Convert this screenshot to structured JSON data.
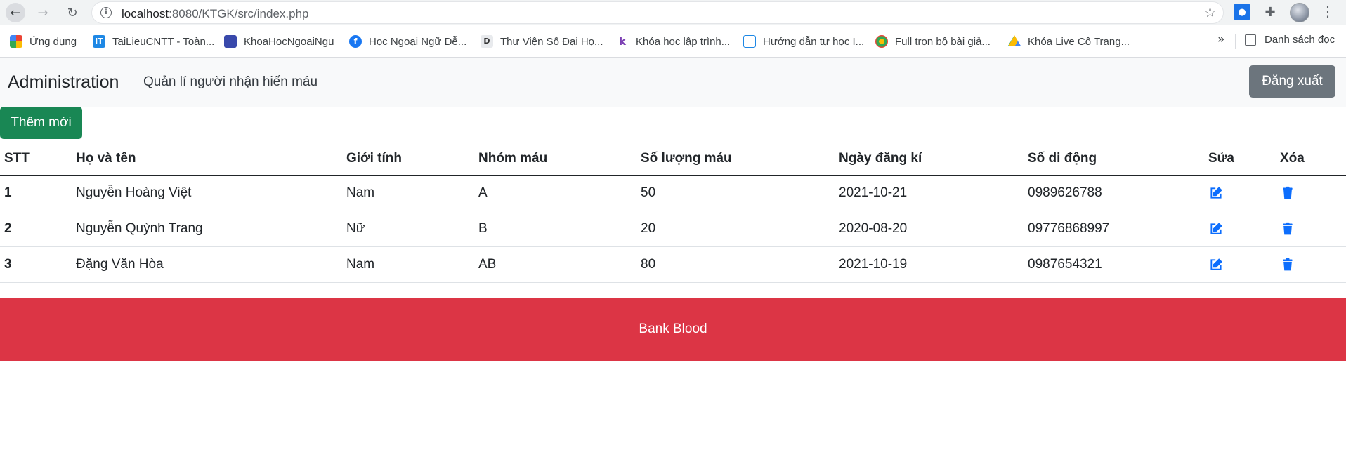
{
  "browser": {
    "url_host": "localhost",
    "url_path": ":8080/KTGK/src/index.php",
    "bookmarks": [
      {
        "label": "Ứng dụng",
        "icon": "apps-grid-icon"
      },
      {
        "label": "TaiLieuCNTT - Toàn...",
        "icon": "it-logo-icon"
      },
      {
        "label": "KhoaHocNgoaiNgu",
        "icon": "site-icon"
      },
      {
        "label": "Học Ngoại Ngữ Dễ...",
        "icon": "facebook-icon"
      },
      {
        "label": "Thư Viện Số Đại Họ...",
        "icon": "library-icon"
      },
      {
        "label": "Khóa học lập trình...",
        "icon": "k-logo-icon"
      },
      {
        "label": "Hướng dẫn tự học I...",
        "icon": "people-icon"
      },
      {
        "label": "Full trọn bộ bài giả...",
        "icon": "globe-icon"
      },
      {
        "label": "Khóa Live Cô Trang...",
        "icon": "google-drive-icon"
      }
    ],
    "more_label": "»",
    "reading_list_label": "Danh sách đọc"
  },
  "navbar": {
    "brand": "Administration",
    "link": "Quản lí người nhận hiến máu",
    "logout_label": "Đăng xuất"
  },
  "actions": {
    "add_label": "Thêm mới"
  },
  "table": {
    "headers": [
      "STT",
      "Họ và tên",
      "Giới tính",
      "Nhóm máu",
      "Số lượng máu",
      "Ngày đăng kí",
      "Số di động",
      "Sửa",
      "Xóa"
    ],
    "rows": [
      {
        "stt": "1",
        "name": "Nguyễn Hoàng Việt",
        "gender": "Nam",
        "blood_group": "A",
        "amount": "50",
        "date": "2021-10-21",
        "phone": "0989626788"
      },
      {
        "stt": "2",
        "name": "Nguyễn Quỳnh Trang",
        "gender": "Nữ",
        "blood_group": "B",
        "amount": "20",
        "date": "2020-08-20",
        "phone": "09776868997"
      },
      {
        "stt": "3",
        "name": "Đặng Văn Hòa",
        "gender": "Nam",
        "blood_group": "AB",
        "amount": "80",
        "date": "2021-10-19",
        "phone": "0987654321"
      }
    ]
  },
  "footer": {
    "text": "Bank Blood"
  },
  "colors": {
    "navbar_bg": "#f8f9fa",
    "logout_bg": "#6c757d",
    "add_bg": "#198754",
    "footer_bg": "#dc3545",
    "icon_color": "#0d6efd"
  }
}
